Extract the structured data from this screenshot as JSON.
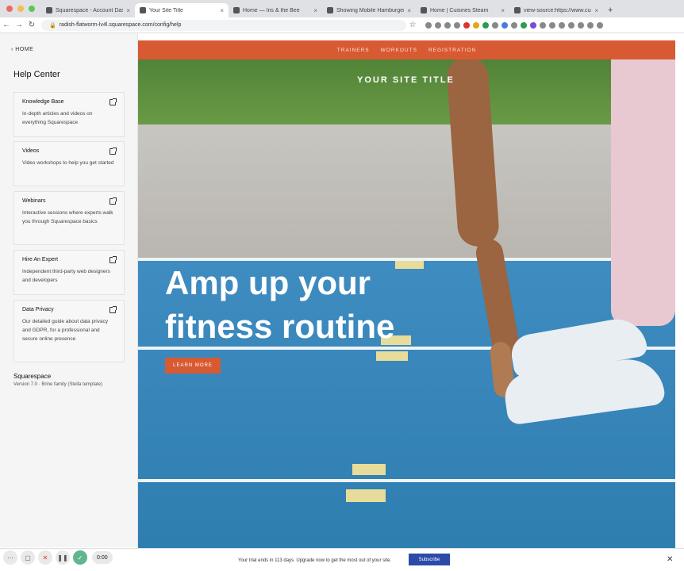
{
  "browser": {
    "tabs": [
      {
        "label": "Squarespace - Account Dash",
        "active": false
      },
      {
        "label": "Your Site Title",
        "active": true
      },
      {
        "label": "Home — Iris & the Bee",
        "active": false
      },
      {
        "label": "Showing Mobile Hamburger M",
        "active": false
      },
      {
        "label": "Home | Cuisines Steam",
        "active": false
      },
      {
        "label": "view-source:https://www.cuisi",
        "active": false
      }
    ],
    "url": "radish-flatworm-lv4l.squarespace.com/config/help"
  },
  "sidebar": {
    "back_label": "HOME",
    "title": "Help Center",
    "cards": [
      {
        "title": "Knowledge Base",
        "desc": "In-depth articles and videos on everything Squarespace"
      },
      {
        "title": "Videos",
        "desc": "Video workshops to help you get started"
      },
      {
        "title": "Webinars",
        "desc": "Interactive sessions where experts walk you through Squarespace basics"
      },
      {
        "title": "Hire An Expert",
        "desc": "Independent third-party web designers and developers"
      },
      {
        "title": "Data Privacy",
        "desc": "Our detailed guide about data privacy and GDPR, for a professional and secure online presence"
      }
    ],
    "footer_title": "Squarespace",
    "footer_version": "Version 7.0 · Brine family (Stella template)"
  },
  "preview": {
    "nav": [
      "TRAINERS",
      "WORKOUTS",
      "REGISTRATION"
    ],
    "site_title": "YOUR SITE TITLE",
    "hero_line1": "Amp up your",
    "hero_line2": "fitness routine",
    "button_label": "LEARN MORE",
    "accent": "#d85a32"
  },
  "bottom": {
    "trial_text": "Your trial ends in 113 days. Upgrade now to get the most out of your site.",
    "subscribe_label": "Subscribe",
    "timer": "0:00"
  }
}
